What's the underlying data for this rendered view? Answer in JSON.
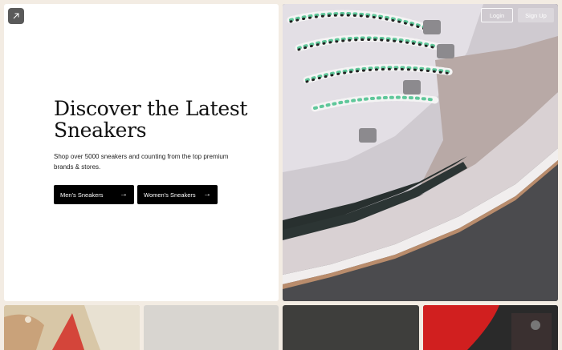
{
  "hero": {
    "headline": "Discover the Latest Sneakers",
    "subtext": "Shop over 5000 sneakers and counting from the top premium brands & stores.",
    "buttons": [
      {
        "label": "Men's Sneakers",
        "icon": "arrow-right-icon"
      },
      {
        "label": "Women's Sneakers",
        "icon": "arrow-right-icon"
      }
    ]
  },
  "header": {
    "logo_icon": "arrow-up-right-icon",
    "login_label": "Login",
    "signup_label": "Sign Up"
  },
  "colors": {
    "background": "#f3ece3",
    "button_bg": "#000000",
    "logo_bg": "#5a5a5a"
  }
}
